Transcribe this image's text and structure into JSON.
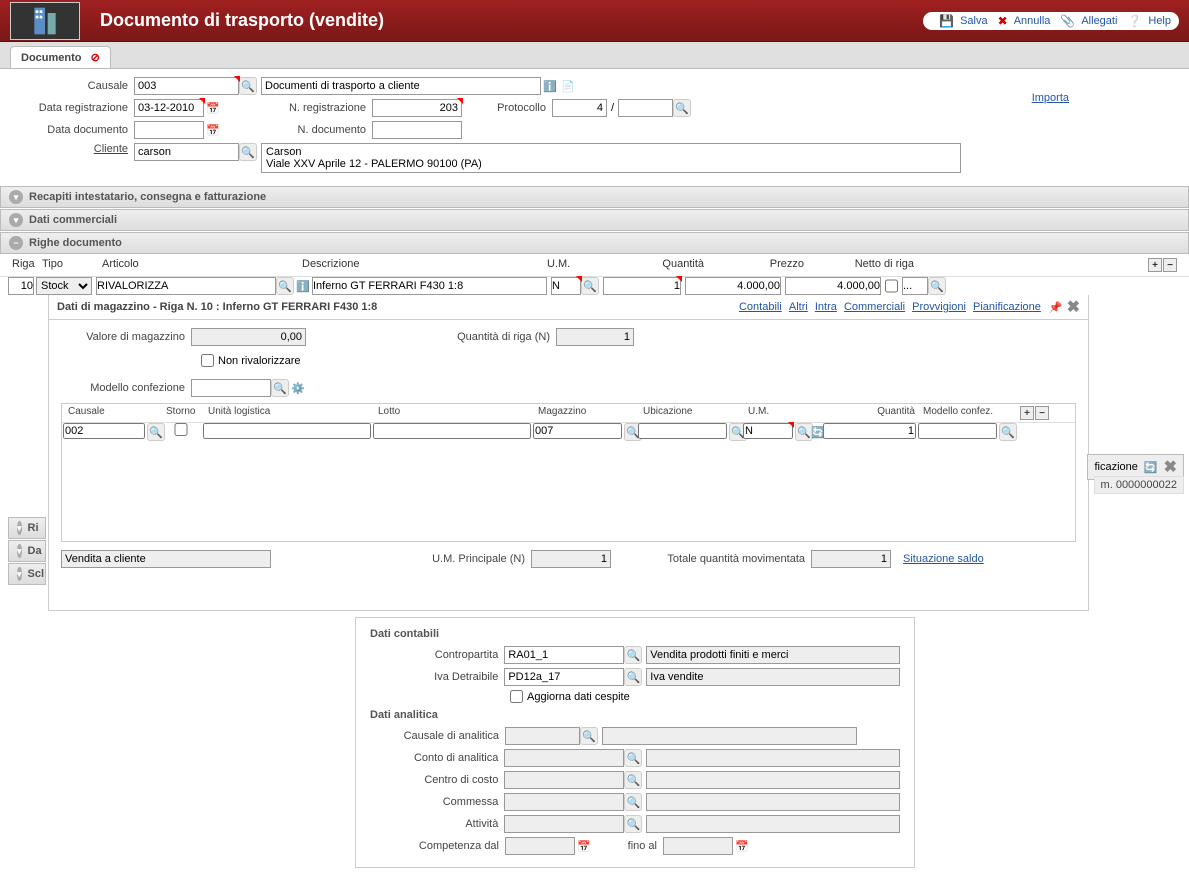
{
  "header": {
    "title": "Documento di trasporto (vendite)",
    "save": "Salva",
    "cancel": "Annulla",
    "attach": "Allegati",
    "help": "Help"
  },
  "tab": {
    "label": "Documento"
  },
  "importa": "Importa",
  "form": {
    "causale_lbl": "Causale",
    "causale_val": "003",
    "causale_desc": "Documenti di trasporto a cliente",
    "data_reg_lbl": "Data registrazione",
    "data_reg_val": "03-12-2010",
    "nreg_lbl": "N. registrazione",
    "nreg_val": "203",
    "protocollo_lbl": "Protocollo",
    "protocollo_val": "4",
    "protocollo_suffix": "/",
    "data_doc_lbl": "Data documento",
    "data_doc_val": "",
    "ndoc_lbl": "N. documento",
    "ndoc_val": "",
    "cliente_lbl": "Cliente",
    "cliente_val": "carson",
    "cliente_name": "Carson",
    "cliente_addr": "Viale XXV Aprile 12 - PALERMO 90100 (PA)"
  },
  "sections": {
    "recapiti": "Recapiti intestatario, consegna e fatturazione",
    "commerciali": "Dati commerciali",
    "righe": "Righe documento",
    "ri": "Ri",
    "da": "Da",
    "scl": "Scl"
  },
  "grid": {
    "cols": {
      "riga": "Riga",
      "tipo": "Tipo",
      "articolo": "Articolo",
      "descrizione": "Descrizione",
      "um": "U.M.",
      "quantita": "Quantità",
      "prezzo": "Prezzo",
      "netto": "Netto di riga"
    },
    "row": {
      "riga": "10",
      "tipo": "Stock",
      "articolo": "RIVALORIZZA",
      "descrizione": "Inferno GT FERRARI F430 1:8",
      "um": "N",
      "quantita": "1",
      "prezzo": "4.000,00",
      "netto": "4.000,00",
      "extra": "..."
    }
  },
  "sub": {
    "title": "Dati di magazzino - Riga N. 10 : Inferno GT FERRARI F430 1:8",
    "links": {
      "contabili": "Contabili",
      "altri": "Altri",
      "intra": "Intra",
      "commerciali": "Commerciali",
      "provvigioni": "Provvigioni",
      "pianificazione": "Pianificazione"
    },
    "valmag_lbl": "Valore di magazzino",
    "valmag_val": "0,00",
    "qtariga_lbl": "Quantità di riga (N)",
    "qtariga_val": "1",
    "nonriv_lbl": "Non rivalorizzare",
    "modconf_lbl": "Modello confezione",
    "modconf_val": "",
    "mcols": {
      "causale": "Causale",
      "storno": "Storno",
      "unita": "Unità logistica",
      "lotto": "Lotto",
      "magazzino": "Magazzino",
      "ubicazione": "Ubicazione",
      "um": "U.M.",
      "quantita": "Quantità",
      "modconf": "Modello confez."
    },
    "mrow": {
      "causale": "002",
      "storno": "",
      "unita": "",
      "lotto": "",
      "magazzino": "007",
      "ubicazione": "",
      "um": "N",
      "quantita": "1",
      "modconf": ""
    },
    "vendita": "Vendita a cliente",
    "umprinc_lbl": "U.M. Principale (N)",
    "umprinc_val": "1",
    "totqta_lbl": "Totale quantità movimentata",
    "totqta_val": "1",
    "saldo": "Situazione saldo"
  },
  "behind": {
    "tab": "ficazione",
    "row": "m. 0000000022"
  },
  "contabili": {
    "h1": "Dati contabili",
    "contropartita_lbl": "Contropartita",
    "contropartita_val": "RA01_1",
    "contropartita_desc": "Vendita prodotti finiti e merci",
    "iva_lbl": "Iva Detraibile",
    "iva_val": "PD12a_17",
    "iva_desc": "Iva vendite",
    "aggiorna_lbl": "Aggiorna dati cespite",
    "h2": "Dati analitica",
    "causale_lbl": "Causale di analitica",
    "conto_lbl": "Conto di analitica",
    "centro_lbl": "Centro di costo",
    "commessa_lbl": "Commessa",
    "attivita_lbl": "Attività",
    "compdal_lbl": "Competenza dal",
    "compdal_val": "",
    "finoal_lbl": "fino al",
    "finoal_val": ""
  }
}
